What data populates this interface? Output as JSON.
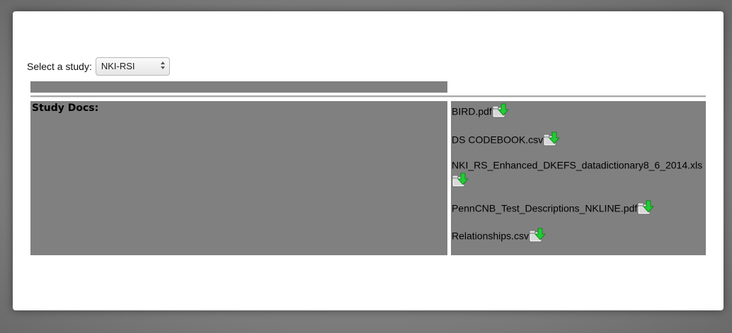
{
  "study_selector": {
    "label": "Select a study:",
    "selected": "NKI-RSI"
  },
  "study_docs": {
    "label": "Study Docs:",
    "files": [
      {
        "name": "BIRD.pdf",
        "icon": "download-icon"
      },
      {
        "name": "DS CODEBOOK.csv",
        "icon": "download-icon"
      },
      {
        "name": "NKI_RS_Enhanced_DKEFS_datadictionary8_6_2014.xls",
        "icon": "download-icon"
      },
      {
        "name": "PennCNB_Test_Descriptions_NKLINE.pdf",
        "icon": "download-icon"
      },
      {
        "name": "Relationships.csv",
        "icon": "download-icon"
      }
    ]
  },
  "colors": {
    "cell_background": "#808080",
    "dialog_background": "#ffffff",
    "download_arrow": "#22cc33"
  }
}
